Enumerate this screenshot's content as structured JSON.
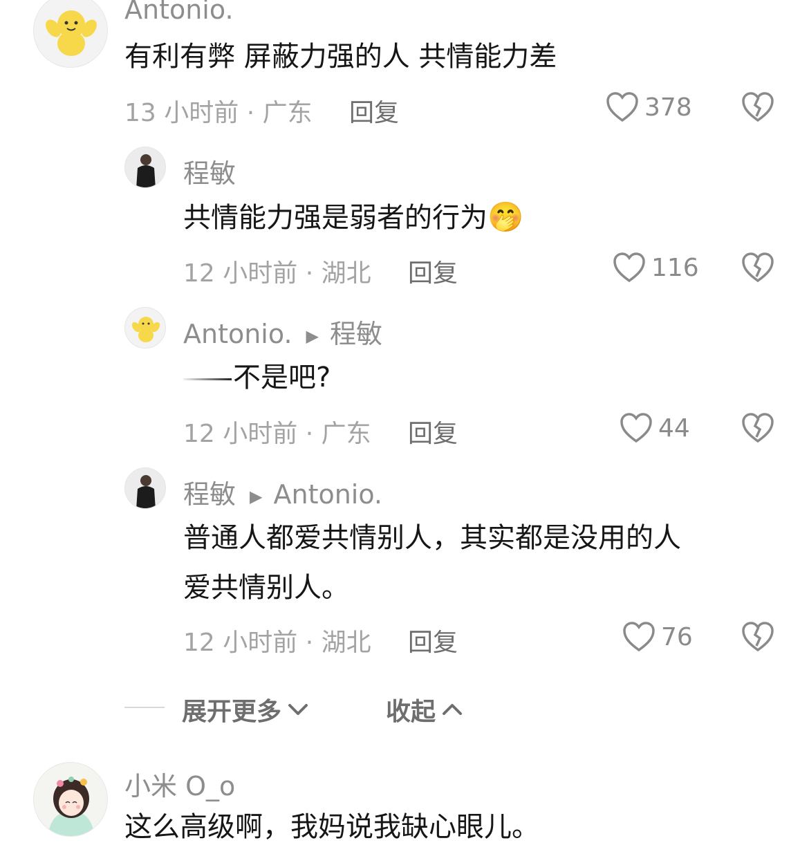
{
  "comments": [
    {
      "user": "Antonio.",
      "text": "有利有弊 屏蔽力强的人 共情能力差",
      "time_location": "13 小时前 · 广东",
      "reply_label": "回复",
      "likes": "378"
    },
    {
      "user": "程敏",
      "text": "共情能力强是弱者的行为",
      "emoji": "🤭",
      "time_location": "12 小时前 · 湖北",
      "reply_label": "回复",
      "likes": "116"
    },
    {
      "user": "Antonio.",
      "reply_to": "程敏",
      "text": "不是吧?",
      "time_location": "12 小时前 · 广东",
      "reply_label": "回复",
      "likes": "44"
    },
    {
      "user": "程敏",
      "reply_to": "Antonio.",
      "text_line1": "普通人都爱共情别人，其实都是没用的人",
      "text_line2": "爱共情别人。",
      "time_location": "12 小时前 · 湖北",
      "reply_label": "回复",
      "likes": "76"
    },
    {
      "user": "小米 O_o",
      "text": "这么高级啊，我妈说我缺心眼儿。"
    }
  ],
  "thread_controls": {
    "expand_more": "展开更多",
    "collapse": "收起"
  },
  "icons": {
    "like": "heart-outline-icon",
    "dislike": "broken-heart-icon",
    "expand": "chevron-down-icon",
    "collapse": "chevron-up-icon",
    "reply_arrow": "triangle-right-icon"
  },
  "colors": {
    "username": "#8d8d8d",
    "text": "#161616",
    "meta": "#a3a3a3"
  }
}
